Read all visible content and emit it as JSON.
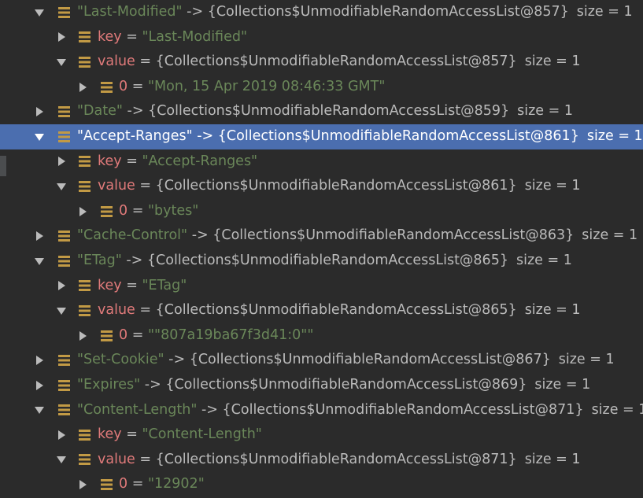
{
  "rows": [
    {
      "level": 0,
      "expanded": true,
      "kind": "entry",
      "name": "\"Last-Modified\"",
      "arrow": "->",
      "ref": "{Collections$UnmodifiableRandomAccessList@857}",
      "size": "size = 1"
    },
    {
      "level": 1,
      "expanded": false,
      "kind": "field",
      "name": "key",
      "eq": "=",
      "value": "\"Last-Modified\""
    },
    {
      "level": 1,
      "expanded": true,
      "kind": "field-ref",
      "name": "value",
      "eq": "=",
      "ref": "{Collections$UnmodifiableRandomAccessList@857}",
      "size": "size = 1"
    },
    {
      "level": 2,
      "expanded": false,
      "kind": "field",
      "name": "0",
      "eq": "=",
      "value": "\"Mon, 15 Apr 2019 08:46:33 GMT\""
    },
    {
      "level": 0,
      "expanded": false,
      "kind": "entry",
      "name": "\"Date\"",
      "arrow": "->",
      "ref": "{Collections$UnmodifiableRandomAccessList@859}",
      "size": "size = 1"
    },
    {
      "level": 0,
      "expanded": true,
      "kind": "entry",
      "selected": true,
      "name": "\"Accept-Ranges\"",
      "arrow": "->",
      "ref": "{Collections$UnmodifiableRandomAccessList@861}",
      "size": "size = 1"
    },
    {
      "level": 1,
      "expanded": false,
      "kind": "field",
      "name": "key",
      "eq": "=",
      "value": "\"Accept-Ranges\""
    },
    {
      "level": 1,
      "expanded": true,
      "kind": "field-ref",
      "name": "value",
      "eq": "=",
      "ref": "{Collections$UnmodifiableRandomAccessList@861}",
      "size": "size = 1"
    },
    {
      "level": 2,
      "expanded": false,
      "kind": "field",
      "name": "0",
      "eq": "=",
      "value": "\"bytes\""
    },
    {
      "level": 0,
      "expanded": false,
      "kind": "entry",
      "name": "\"Cache-Control\"",
      "arrow": "->",
      "ref": "{Collections$UnmodifiableRandomAccessList@863}",
      "size": "size = 1"
    },
    {
      "level": 0,
      "expanded": true,
      "kind": "entry",
      "name": "\"ETag\"",
      "arrow": "->",
      "ref": "{Collections$UnmodifiableRandomAccessList@865}",
      "size": "size = 1"
    },
    {
      "level": 1,
      "expanded": false,
      "kind": "field",
      "name": "key",
      "eq": "=",
      "value": "\"ETag\""
    },
    {
      "level": 1,
      "expanded": true,
      "kind": "field-ref",
      "name": "value",
      "eq": "=",
      "ref": "{Collections$UnmodifiableRandomAccessList@865}",
      "size": "size = 1"
    },
    {
      "level": 2,
      "expanded": false,
      "kind": "field",
      "name": "0",
      "eq": "=",
      "value": "\"\"807a19ba67f3d41:0\"\""
    },
    {
      "level": 0,
      "expanded": false,
      "kind": "entry",
      "name": "\"Set-Cookie\"",
      "arrow": "->",
      "ref": "{Collections$UnmodifiableRandomAccessList@867}",
      "size": "size = 1"
    },
    {
      "level": 0,
      "expanded": false,
      "kind": "entry",
      "name": "\"Expires\"",
      "arrow": "->",
      "ref": "{Collections$UnmodifiableRandomAccessList@869}",
      "size": "size = 1"
    },
    {
      "level": 0,
      "expanded": true,
      "kind": "entry",
      "name": "\"Content-Length\"",
      "arrow": "->",
      "ref": "{Collections$UnmodifiableRandomAccessList@871}",
      "size": "size = 1"
    },
    {
      "level": 1,
      "expanded": false,
      "kind": "field",
      "name": "key",
      "eq": "=",
      "value": "\"Content-Length\""
    },
    {
      "level": 1,
      "expanded": true,
      "kind": "field-ref",
      "name": "value",
      "eq": "=",
      "ref": "{Collections$UnmodifiableRandomAccessList@871}",
      "size": "size = 1"
    },
    {
      "level": 2,
      "expanded": false,
      "kind": "field",
      "name": "0",
      "eq": "=",
      "value": "\"12902\""
    }
  ],
  "icons": {
    "expanded": "chevron-down-icon",
    "collapsed": "chevron-right-icon",
    "field": "field-icon"
  },
  "colors": {
    "background": "#2b2b2b",
    "selection": "#4b6eaf",
    "string": "#6a8759",
    "keyword": "#cc7832",
    "fieldName": "#e07a7a",
    "icon": "#c29a45"
  }
}
